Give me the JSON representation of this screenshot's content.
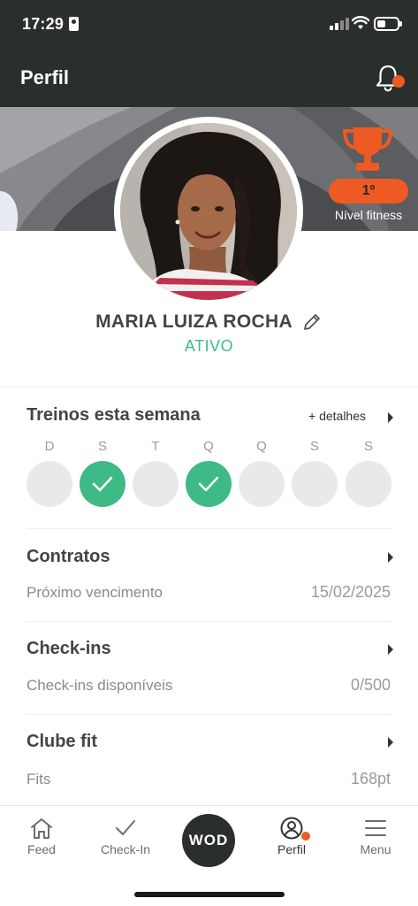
{
  "status_bar": {
    "time": "17:29"
  },
  "header": {
    "title": "Perfil",
    "bell_icon": "bell-icon"
  },
  "colors": {
    "accent": "#ee5a24",
    "success": "#3dba86",
    "dark": "#2b2f2c"
  },
  "rank": {
    "icon": "trophy-icon",
    "position": "1º",
    "label": "Nível fitness"
  },
  "profile": {
    "name": "MARIA LUIZA ROCHA",
    "status": "ATIVO"
  },
  "week": {
    "title": "Treinos esta semana",
    "details_label": "+ detalhes",
    "days": [
      {
        "letter": "D",
        "done": false
      },
      {
        "letter": "S",
        "done": true
      },
      {
        "letter": "T",
        "done": false
      },
      {
        "letter": "Q",
        "done": true
      },
      {
        "letter": "Q",
        "done": false
      },
      {
        "letter": "S",
        "done": false
      },
      {
        "letter": "S",
        "done": false
      }
    ]
  },
  "contracts": {
    "title": "Contratos",
    "label": "Próximo vencimento",
    "value": "15/02/2025"
  },
  "checkins": {
    "title": "Check-ins",
    "label": "Check-ins disponíveis",
    "value": "0/500"
  },
  "club": {
    "title": "Clube fit",
    "label": "Fits",
    "value": "168pt"
  },
  "nav": {
    "feed": "Feed",
    "checkin": "Check-In",
    "wod": "WOD",
    "perfil": "Perfil",
    "menu": "Menu"
  }
}
